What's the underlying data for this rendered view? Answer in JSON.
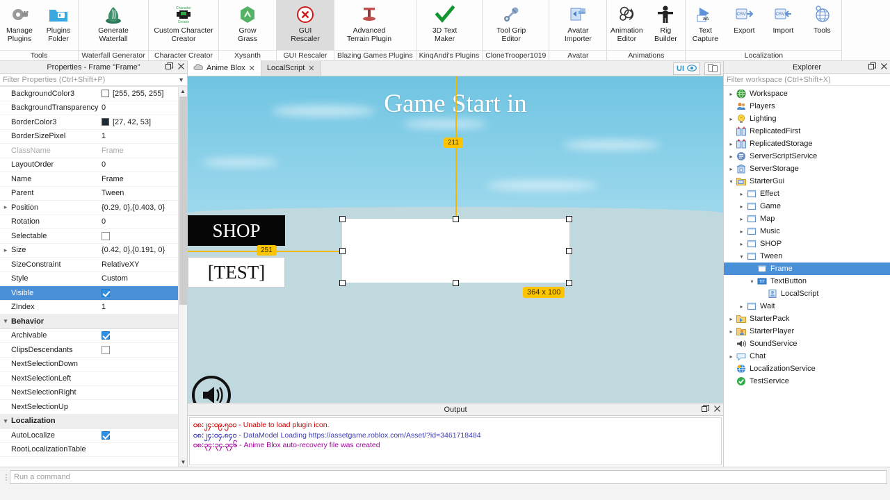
{
  "ribbon": {
    "groups": [
      {
        "label": "Tools",
        "items": [
          {
            "name": "manage-plugins",
            "label": "Manage\nPlugins",
            "icon": "plugin-gear-icon"
          },
          {
            "name": "plugins-folder",
            "label": "Plugins\nFolder",
            "icon": "folder-plugin-icon"
          }
        ]
      },
      {
        "label": "Waterfall Generator",
        "items": [
          {
            "name": "generate-waterfall",
            "label": "Generate\nWaterfall",
            "icon": "waterfall-icon"
          }
        ]
      },
      {
        "label": "Character Creator",
        "items": [
          {
            "name": "custom-character-creator",
            "label": "Custom Character\nCreator",
            "icon": "character-creator-icon"
          }
        ]
      },
      {
        "label": "Xysanth",
        "items": [
          {
            "name": "grow-grass",
            "label": "Grow\nGrass",
            "icon": "grass-icon"
          }
        ]
      },
      {
        "label": "GUI Rescaler",
        "items": [
          {
            "name": "gui-rescaler",
            "label": "GUI\nRescaler",
            "icon": "red-x-circle-icon",
            "selected": true
          }
        ]
      },
      {
        "label": "Blazing Games Plugins",
        "items": [
          {
            "name": "advanced-terrain-plugin",
            "label": "Advanced\nTerrain Plugin",
            "icon": "terrain-t-icon"
          }
        ]
      },
      {
        "label": "KinqAndi's Plugins",
        "items": [
          {
            "name": "3d-text-maker",
            "label": "3D Text\nMaker",
            "icon": "green-check-icon"
          }
        ]
      },
      {
        "label": "CloneTrooper1019",
        "items": [
          {
            "name": "tool-grip-editor",
            "label": "Tool Grip\nEditor",
            "icon": "wrench-icon"
          }
        ]
      },
      {
        "label": "Avatar",
        "items": [
          {
            "name": "avatar-importer",
            "label": "Avatar\nImporter",
            "icon": "import-avatar-icon"
          }
        ]
      },
      {
        "label": "Animations",
        "items": [
          {
            "name": "animation-editor",
            "label": "Animation\nEditor",
            "icon": "animation-icon"
          },
          {
            "name": "rig-builder",
            "label": "Rig\nBuilder",
            "icon": "rig-figure-icon"
          }
        ]
      },
      {
        "label": "Localization",
        "items": [
          {
            "name": "text-capture",
            "label": "Text\nCapture",
            "icon": "text-capture-icon"
          },
          {
            "name": "export",
            "label": "Export",
            "icon": "csv-export-icon"
          },
          {
            "name": "import",
            "label": "Import",
            "icon": "csv-import-icon"
          },
          {
            "name": "tools",
            "label": "Tools",
            "icon": "globe-tools-icon"
          }
        ]
      }
    ]
  },
  "properties": {
    "title": "Properties - Frame \"Frame\"",
    "filter_placeholder": "Filter Properties (Ctrl+Shift+P)",
    "rows": [
      {
        "name": "BackgroundColor3",
        "value": "[255, 255, 255]",
        "type": "color",
        "color": "#ffffff",
        "expandable": false
      },
      {
        "name": "BackgroundTransparency",
        "value": "0",
        "type": "text",
        "expandable": false
      },
      {
        "name": "BorderColor3",
        "value": "[27, 42, 53]",
        "type": "color",
        "color": "#1b2a35",
        "expandable": false
      },
      {
        "name": "BorderSizePixel",
        "value": "1",
        "type": "text",
        "expandable": false
      },
      {
        "name": "ClassName",
        "value": "Frame",
        "type": "text",
        "dim": true,
        "expandable": false
      },
      {
        "name": "LayoutOrder",
        "value": "0",
        "type": "text",
        "expandable": false
      },
      {
        "name": "Name",
        "value": "Frame",
        "type": "text",
        "expandable": false
      },
      {
        "name": "Parent",
        "value": "Tween",
        "type": "text",
        "expandable": false
      },
      {
        "name": "Position",
        "value": "{0.29, 0},{0.403, 0}",
        "type": "text",
        "expandable": true
      },
      {
        "name": "Rotation",
        "value": "0",
        "type": "text",
        "expandable": false
      },
      {
        "name": "Selectable",
        "value": "",
        "type": "checkbox",
        "checked": false,
        "expandable": false
      },
      {
        "name": "Size",
        "value": "{0.42, 0},{0.191, 0}",
        "type": "text",
        "expandable": true
      },
      {
        "name": "SizeConstraint",
        "value": "RelativeXY",
        "type": "text",
        "expandable": false
      },
      {
        "name": "Style",
        "value": "Custom",
        "type": "text",
        "expandable": false
      },
      {
        "name": "Visible",
        "value": "",
        "type": "checkbox",
        "checked": true,
        "selected": true,
        "expandable": false
      },
      {
        "name": "ZIndex",
        "value": "1",
        "type": "text",
        "expandable": false
      },
      {
        "name": "Behavior",
        "value": "",
        "type": "section",
        "expandable": true
      },
      {
        "name": "Archivable",
        "value": "",
        "type": "checkbox",
        "checked": true,
        "expandable": false
      },
      {
        "name": "ClipsDescendants",
        "value": "",
        "type": "checkbox",
        "checked": false,
        "expandable": false
      },
      {
        "name": "NextSelectionDown",
        "value": "",
        "type": "text",
        "expandable": false
      },
      {
        "name": "NextSelectionLeft",
        "value": "",
        "type": "text",
        "expandable": false
      },
      {
        "name": "NextSelectionRight",
        "value": "",
        "type": "text",
        "expandable": false
      },
      {
        "name": "NextSelectionUp",
        "value": "",
        "type": "text",
        "expandable": false
      },
      {
        "name": "Localization",
        "value": "",
        "type": "section",
        "expandable": true
      },
      {
        "name": "AutoLocalize",
        "value": "",
        "type": "checkbox",
        "checked": true,
        "expandable": false
      },
      {
        "name": "RootLocalizationTable",
        "value": "",
        "type": "text",
        "expandable": false
      }
    ]
  },
  "center": {
    "tabs": [
      {
        "name": "tab-anime-blox",
        "label": "Anime Blox",
        "active": true,
        "icon": "cloud-icon"
      },
      {
        "name": "tab-localscript",
        "label": "LocalScript",
        "active": false,
        "icon": "none"
      }
    ],
    "ui_toggle_label": "UI",
    "viewport": {
      "game_title": "Game Start in",
      "shop_button": "SHOP",
      "test_button": "[TEST]",
      "vertical_guide_value": "211",
      "horizontal_guide_value": "251",
      "size_badge": "364 x 100",
      "guide_color": "#f0b800",
      "badge_color": "#ffc400"
    }
  },
  "output": {
    "title": "Output",
    "lines": [
      {
        "timestamp": "၀၈:၂၄:၀၉.၅၀၀",
        "text": "- Unable to load plugin icon.",
        "color": "#cc0000"
      },
      {
        "timestamp": "၀၈:၂၄:၀၄.၈၄၀",
        "text": "- DataModel Loading https://assetgame.roblox.com/Asset/?id=3461718484",
        "color": "#3b3bb5"
      },
      {
        "timestamp": "၀၈:၃၄:၃၄.၃၄၆",
        "text": "- Anime Blox auto-recovery file was created",
        "color": "#a5009e"
      }
    ]
  },
  "explorer": {
    "title": "Explorer",
    "filter_placeholder": "Filter workspace (Ctrl+Shift+X)",
    "tree": [
      {
        "label": "Workspace",
        "depth": 0,
        "twisty": "collapsed",
        "icon": "workspace-globe-icon"
      },
      {
        "label": "Players",
        "depth": 0,
        "twisty": "none",
        "icon": "players-icon"
      },
      {
        "label": "Lighting",
        "depth": 0,
        "twisty": "collapsed",
        "icon": "lighting-bulb-icon"
      },
      {
        "label": "ReplicatedFirst",
        "depth": 0,
        "twisty": "none",
        "icon": "replicated-icon"
      },
      {
        "label": "ReplicatedStorage",
        "depth": 0,
        "twisty": "collapsed",
        "icon": "replicated-icon"
      },
      {
        "label": "ServerScriptService",
        "depth": 0,
        "twisty": "collapsed",
        "icon": "server-script-icon"
      },
      {
        "label": "ServerStorage",
        "depth": 0,
        "twisty": "collapsed",
        "icon": "server-storage-icon"
      },
      {
        "label": "StarterGui",
        "depth": 0,
        "twisty": "expanded",
        "icon": "starter-gui-icon"
      },
      {
        "label": "Effect",
        "depth": 1,
        "twisty": "collapsed",
        "icon": "screengui-icon"
      },
      {
        "label": "Game",
        "depth": 1,
        "twisty": "collapsed",
        "icon": "screengui-icon"
      },
      {
        "label": "Map",
        "depth": 1,
        "twisty": "collapsed",
        "icon": "screengui-icon"
      },
      {
        "label": "Music",
        "depth": 1,
        "twisty": "collapsed",
        "icon": "screengui-icon"
      },
      {
        "label": "SHOP",
        "depth": 1,
        "twisty": "collapsed",
        "icon": "screengui-icon"
      },
      {
        "label": "Tween",
        "depth": 1,
        "twisty": "expanded",
        "icon": "screengui-icon"
      },
      {
        "label": "Frame",
        "depth": 2,
        "twisty": "none",
        "icon": "frame-icon",
        "selected": true
      },
      {
        "label": "TextButton",
        "depth": 2,
        "twisty": "expanded",
        "icon": "textbutton-icon"
      },
      {
        "label": "LocalScript",
        "depth": 3,
        "twisty": "none",
        "icon": "localscript-icon"
      },
      {
        "label": "Wait",
        "depth": 1,
        "twisty": "collapsed",
        "icon": "screengui-icon"
      },
      {
        "label": "StarterPack",
        "depth": 0,
        "twisty": "collapsed",
        "icon": "starter-pack-icon"
      },
      {
        "label": "StarterPlayer",
        "depth": 0,
        "twisty": "collapsed",
        "icon": "starter-player-icon"
      },
      {
        "label": "SoundService",
        "depth": 0,
        "twisty": "none",
        "icon": "sound-service-icon"
      },
      {
        "label": "Chat",
        "depth": 0,
        "twisty": "collapsed",
        "icon": "chat-icon"
      },
      {
        "label": "LocalizationService",
        "depth": 0,
        "twisty": "none",
        "icon": "localization-service-icon"
      },
      {
        "label": "TestService",
        "depth": 0,
        "twisty": "none",
        "icon": "test-service-icon"
      }
    ]
  },
  "command_bar": {
    "placeholder": "Run a command"
  }
}
